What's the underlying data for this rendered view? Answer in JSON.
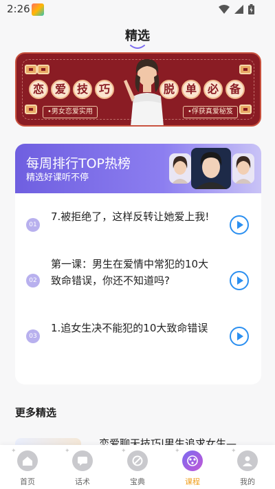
{
  "status_bar": {
    "time": "2:26",
    "icons": [
      "wifi-icon",
      "signal-icon",
      "battery-icon"
    ]
  },
  "header": {
    "title": "精选"
  },
  "banner": {
    "left_chars": [
      "恋",
      "爱",
      "技",
      "巧"
    ],
    "right_chars": [
      "脱",
      "单",
      "必",
      "备"
    ],
    "left_tag": "•男女恋爱实用",
    "right_tag": "•俘获真爱秘笈"
  },
  "ranking": {
    "title": "每周排行TOP热榜",
    "subtitle": "精选好课听不停",
    "items": [
      {
        "num": "01",
        "text": "7.被拒绝了，这样反转让她爱上我!"
      },
      {
        "num": "02",
        "text": "第一课：男生在爱情中常犯的10大致命错误，你还不知道吗?"
      },
      {
        "num": "03",
        "text": "1.追女生决不能犯的10大致命错误"
      }
    ]
  },
  "more": {
    "title": "更多精选",
    "first_item_text": "恋爱聊天技巧|男生追求女生—"
  },
  "nav": {
    "items": [
      {
        "label": "首页",
        "icon": "home-icon"
      },
      {
        "label": "话术",
        "icon": "chat-icon"
      },
      {
        "label": "宝典",
        "icon": "book-icon"
      },
      {
        "label": "课程",
        "icon": "course-icon",
        "active": true
      },
      {
        "label": "我的",
        "icon": "profile-icon"
      }
    ]
  },
  "colors": {
    "accent_purple": "#7b6bf0",
    "nav_active": "#f0a020",
    "play_blue": "#2b8ff0",
    "banner_red": "#8a1c24"
  }
}
